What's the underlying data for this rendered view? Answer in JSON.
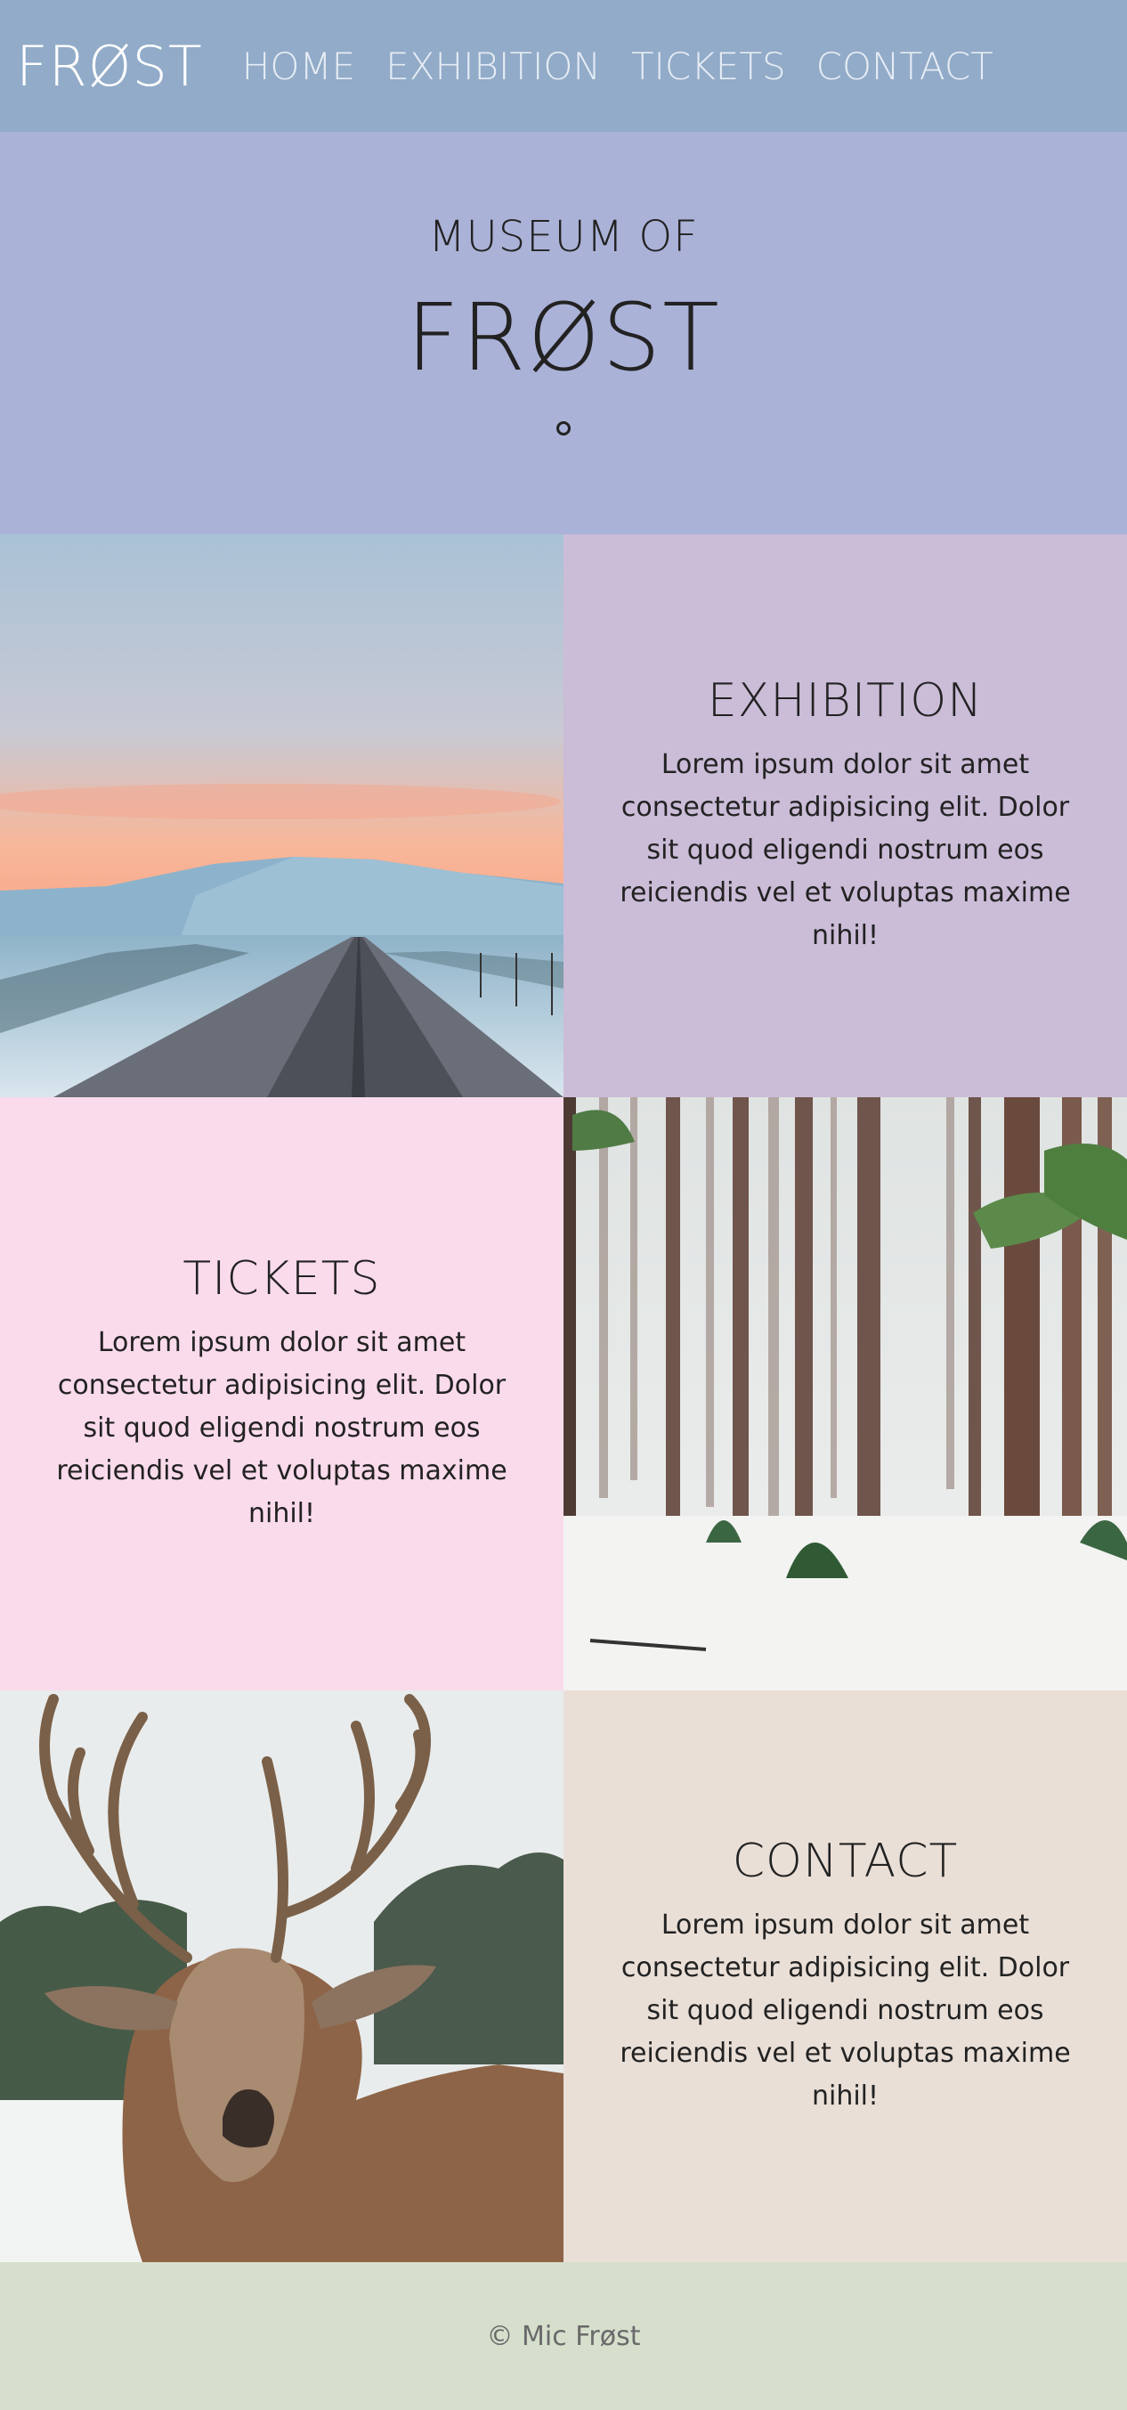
{
  "nav": {
    "logo": "FRØST",
    "links": [
      "HOME",
      "EXHIBITION",
      "TICKETS",
      "CONTACT"
    ]
  },
  "hero": {
    "kicker": "MUSEUM OF",
    "title": "FRØST"
  },
  "sections": {
    "exhibition": {
      "title": "EXHIBITION",
      "text": "Lorem ipsum dolor sit amet consectetur adipisicing elit. Dolor sit quod eligendi nostrum eos reiciendis vel et voluptas maxime nihil!"
    },
    "tickets": {
      "title": "TICKETS",
      "text": "Lorem ipsum dolor sit amet consectetur adipisicing elit. Dolor sit quod eligendi nostrum eos reiciendis vel et voluptas maxime nihil!"
    },
    "contact": {
      "title": "CONTACT",
      "text": "Lorem ipsum dolor sit amet consectetur adipisicing elit. Dolor sit quod eligendi nostrum eos reiciendis vel et voluptas maxime nihil!"
    }
  },
  "footer": {
    "text": "© Mic Frøst"
  },
  "colors": {
    "nav_bg": "#91abc8",
    "hero_bg": "#abb2d7",
    "exhibition_bg": "#cbbcd8",
    "tickets_bg": "#fadbeb",
    "contact_bg": "#eadfd7",
    "footer_bg": "#d6dfcc"
  }
}
